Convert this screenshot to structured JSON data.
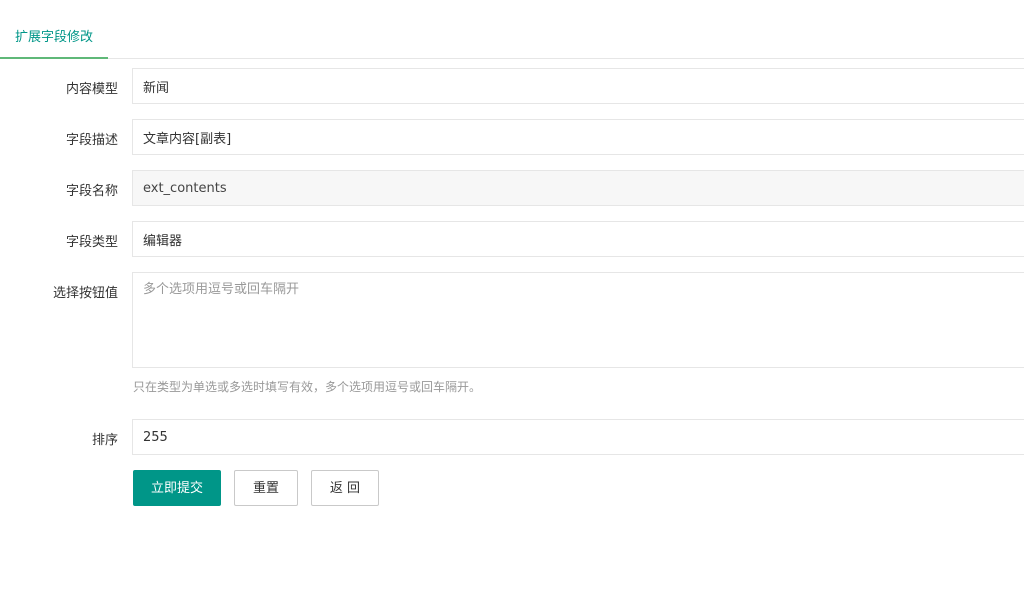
{
  "tabs": [
    {
      "label": "扩展字段修改",
      "active": true
    }
  ],
  "form": {
    "content_model": {
      "label": "内容模型",
      "value": "新闻"
    },
    "field_description": {
      "label": "字段描述",
      "value": "文章内容[副表]"
    },
    "field_name": {
      "label": "字段名称",
      "value": "ext_contents"
    },
    "field_type": {
      "label": "字段类型",
      "value": "编辑器"
    },
    "options": {
      "label": "选择按钮值",
      "value": "",
      "placeholder": "多个选项用逗号或回车隔开",
      "help": "只在类型为单选或多选时填写有效，多个选项用逗号或回车隔开。"
    },
    "sort": {
      "label": "排序",
      "value": "255"
    }
  },
  "buttons": {
    "submit": "立即提交",
    "reset": "重置",
    "back": "返 回"
  },
  "colors": {
    "primary": "#009688",
    "tab_underline": "#5FB878",
    "border": "#e6e6e6",
    "help_text": "#999999"
  }
}
